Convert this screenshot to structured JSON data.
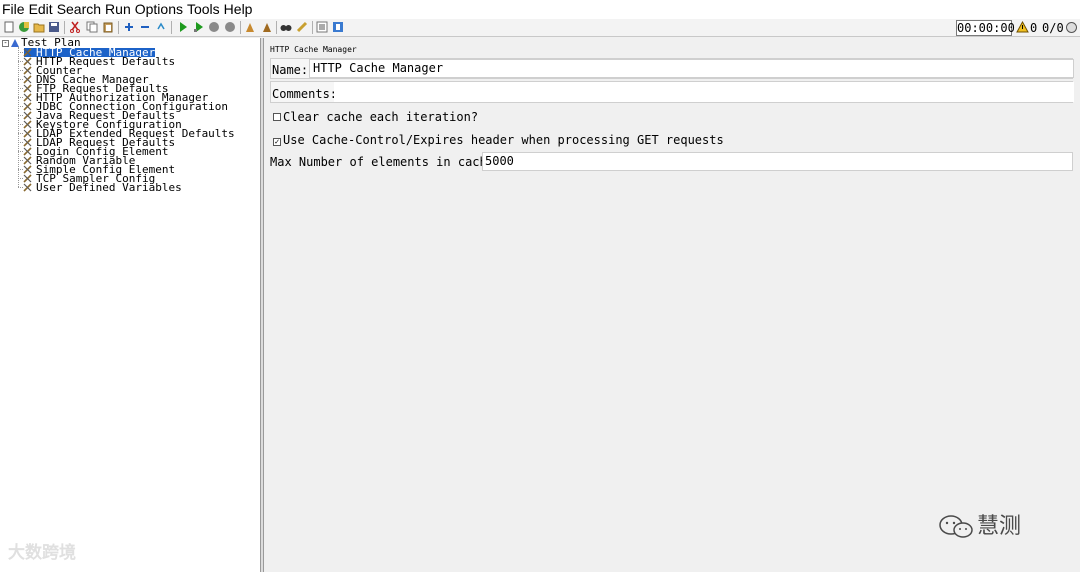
{
  "menu": [
    "File",
    "Edit",
    "Search",
    "Run",
    "Options",
    "Tools",
    "Help"
  ],
  "toolbar": {
    "timer": "00:00:00",
    "warning_count": "0",
    "threads": "0/0"
  },
  "tree": {
    "root": "Test Plan",
    "items": [
      "HTTP Cache Manager",
      "HTTP Request Defaults",
      "Counter",
      "DNS Cache Manager",
      "FTP Request Defaults",
      "HTTP Authorization Manager",
      "JDBC Connection Configuration",
      "Java Request Defaults",
      "Keystore Configuration",
      "LDAP Extended Request Defaults",
      "LDAP Request Defaults",
      "Login Config Element",
      "Random Variable",
      "Simple Config Element",
      "TCP Sampler Config",
      "User Defined Variables"
    ]
  },
  "panel": {
    "title": "HTTP Cache Manager",
    "name_label": "Name:",
    "name_value": "HTTP Cache Manager",
    "comments_label": "Comments:",
    "comments_value": "",
    "clear_cache_label": "Clear cache each iteration?",
    "clear_cache_checked": false,
    "use_cache_control_label": "Use Cache-Control/Expires header when processing GET requests",
    "use_cache_control_checked": true,
    "max_elements_label": "Max Number of elements in cache",
    "max_elements_value": "5000"
  },
  "watermarks": {
    "left": "大数跨境",
    "right": "慧测"
  }
}
